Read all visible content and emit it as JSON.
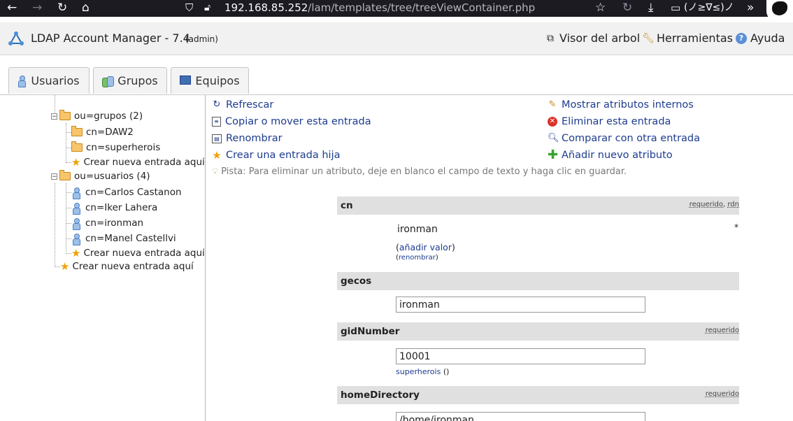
{
  "browser": {
    "url_host": "192.168.85.252",
    "url_path": "/lam/templates/tree/treeViewContainer.php",
    "kaomoji": "(ノ≥∇≤)ノ",
    "overflow": "»"
  },
  "header": {
    "title": "LDAP Account Manager - 7.4",
    "user": "(admin)",
    "links": [
      "Visor del arbol",
      "Herramientas",
      "Ayuda"
    ]
  },
  "tabs": [
    "Usuarios",
    "Grupos",
    "Equipos"
  ],
  "tree": {
    "grupos_ou": "ou=grupos (2)",
    "grupos_children": [
      "cn=DAW2",
      "cn=superherois"
    ],
    "create_new": "Crear nueva entrada aquí",
    "usuarios_ou": "ou=usuarios (4)",
    "usuarios_children": [
      "cn=Carlos Castanon",
      "cn=Iker Lahera",
      "cn=ironman",
      "cn=Manel Castellvi"
    ]
  },
  "actions": {
    "refresh": "Refrescar",
    "show_internal": "Mostrar atributos internos",
    "copy_move": "Copiar o mover esta entrada",
    "delete": "Eliminar esta entrada",
    "rename": "Renombrar",
    "compare": "Comparar con otra entrada",
    "create_child": "Crear una entrada hija",
    "add_attribute": "Añadir nuevo atributo"
  },
  "hint": "Pista: Para eliminar un atributo, deje en blanco el campo de texto y haga clic en guardar.",
  "attributes": {
    "cn": {
      "name": "cn",
      "flag1": "requerido",
      "flag2": "rdn",
      "value": "ironman",
      "marker": "*",
      "add_value": "añadir valor",
      "rename": "renombrar"
    },
    "gecos": {
      "name": "gecos",
      "value": "ironman"
    },
    "gidNumber": {
      "name": "gidNumber",
      "flag1": "requerido",
      "value": "10001",
      "group_link": "superherois",
      "group_suffix": "()"
    },
    "homeDirectory": {
      "name": "homeDirectory",
      "flag1": "requerido",
      "value": "/home/ironman"
    }
  },
  "colors": {
    "link": "#1d3c8f",
    "attr_header": "#e0e0e0",
    "browser_bar": "#1c1b22"
  }
}
